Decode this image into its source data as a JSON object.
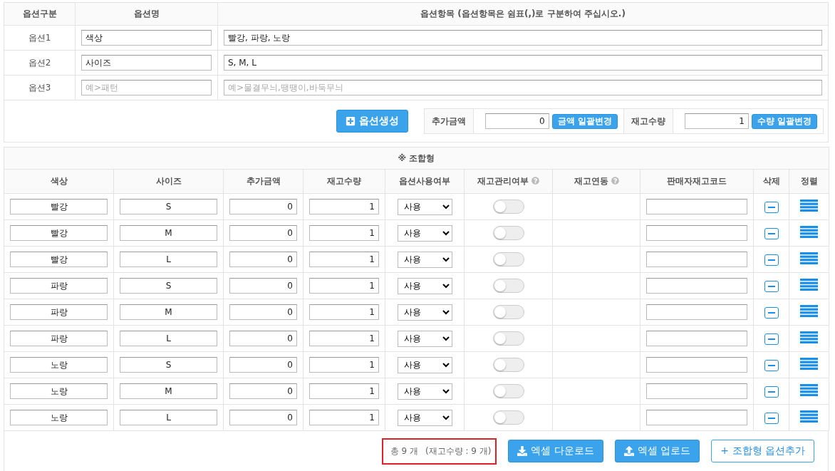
{
  "option_table": {
    "columns": [
      "옵션구분",
      "옵션명",
      "옵션항목 (옵션항목은 쉼표(,)로 구분하여 주십시오.)"
    ],
    "rows": [
      {
        "label": "옵션1",
        "name": {
          "value": "색상"
        },
        "items": {
          "value": "빨강, 파랑, 노랑"
        }
      },
      {
        "label": "옵션2",
        "name": {
          "value": "사이즈"
        },
        "items": {
          "value": "S, M, L"
        }
      },
      {
        "label": "옵션3",
        "name": {
          "placeholder": "예>패턴"
        },
        "items": {
          "placeholder": "예>물결무늬,땡땡이,바둑무늬"
        }
      }
    ],
    "create_button": "옵션생성",
    "bulk": [
      {
        "label": "추가금액",
        "value": "0",
        "button": "금액 일괄변경"
      },
      {
        "label": "재고수량",
        "value": "1",
        "button": "수량 일괄변경"
      }
    ]
  },
  "combo_table": {
    "caption": "※ 조합형",
    "columns": [
      {
        "label": "색상",
        "help": false
      },
      {
        "label": "사이즈",
        "help": false
      },
      {
        "label": "추가금액",
        "help": false
      },
      {
        "label": "재고수량",
        "help": false
      },
      {
        "label": "옵션사용여부",
        "help": false
      },
      {
        "label": "재고관리여부",
        "help": true
      },
      {
        "label": "재고연동",
        "help": true
      },
      {
        "label": "판매자재고코드",
        "help": false
      },
      {
        "label": "삭제",
        "help": false
      },
      {
        "label": "정렬",
        "help": false
      }
    ],
    "rows": [
      {
        "option_1": "빨강",
        "option_2": "S",
        "price": "0",
        "stock": "1",
        "use": "사용",
        "stock_managed": false
      },
      {
        "option_1": "빨강",
        "option_2": "M",
        "price": "0",
        "stock": "1",
        "use": "사용",
        "stock_managed": false
      },
      {
        "option_1": "빨강",
        "option_2": "L",
        "price": "0",
        "stock": "1",
        "use": "사용",
        "stock_managed": false
      },
      {
        "option_1": "파랑",
        "option_2": "S",
        "price": "0",
        "stock": "1",
        "use": "사용",
        "stock_managed": false
      },
      {
        "option_1": "파랑",
        "option_2": "M",
        "price": "0",
        "stock": "1",
        "use": "사용",
        "stock_managed": false
      },
      {
        "option_1": "파랑",
        "option_2": "L",
        "price": "0",
        "stock": "1",
        "use": "사용",
        "stock_managed": false
      },
      {
        "option_1": "노랑",
        "option_2": "S",
        "price": "0",
        "stock": "1",
        "use": "사용",
        "stock_managed": false
      },
      {
        "option_1": "노랑",
        "option_2": "M",
        "price": "0",
        "stock": "1",
        "use": "사용",
        "stock_managed": false
      },
      {
        "option_1": "노랑",
        "option_2": "L",
        "price": "0",
        "stock": "1",
        "use": "사용",
        "stock_managed": false
      }
    ],
    "summary": {
      "total": "총 9 개",
      "stock": "(재고수량 : 9 개)",
      "highlighted": true
    },
    "buttons": [
      {
        "kind": "download",
        "label": "엑셀 다운로드"
      },
      {
        "kind": "upload",
        "label": "엑셀 업로드"
      },
      {
        "kind": "add",
        "label": "+ 조합형 옵션추가"
      }
    ]
  }
}
